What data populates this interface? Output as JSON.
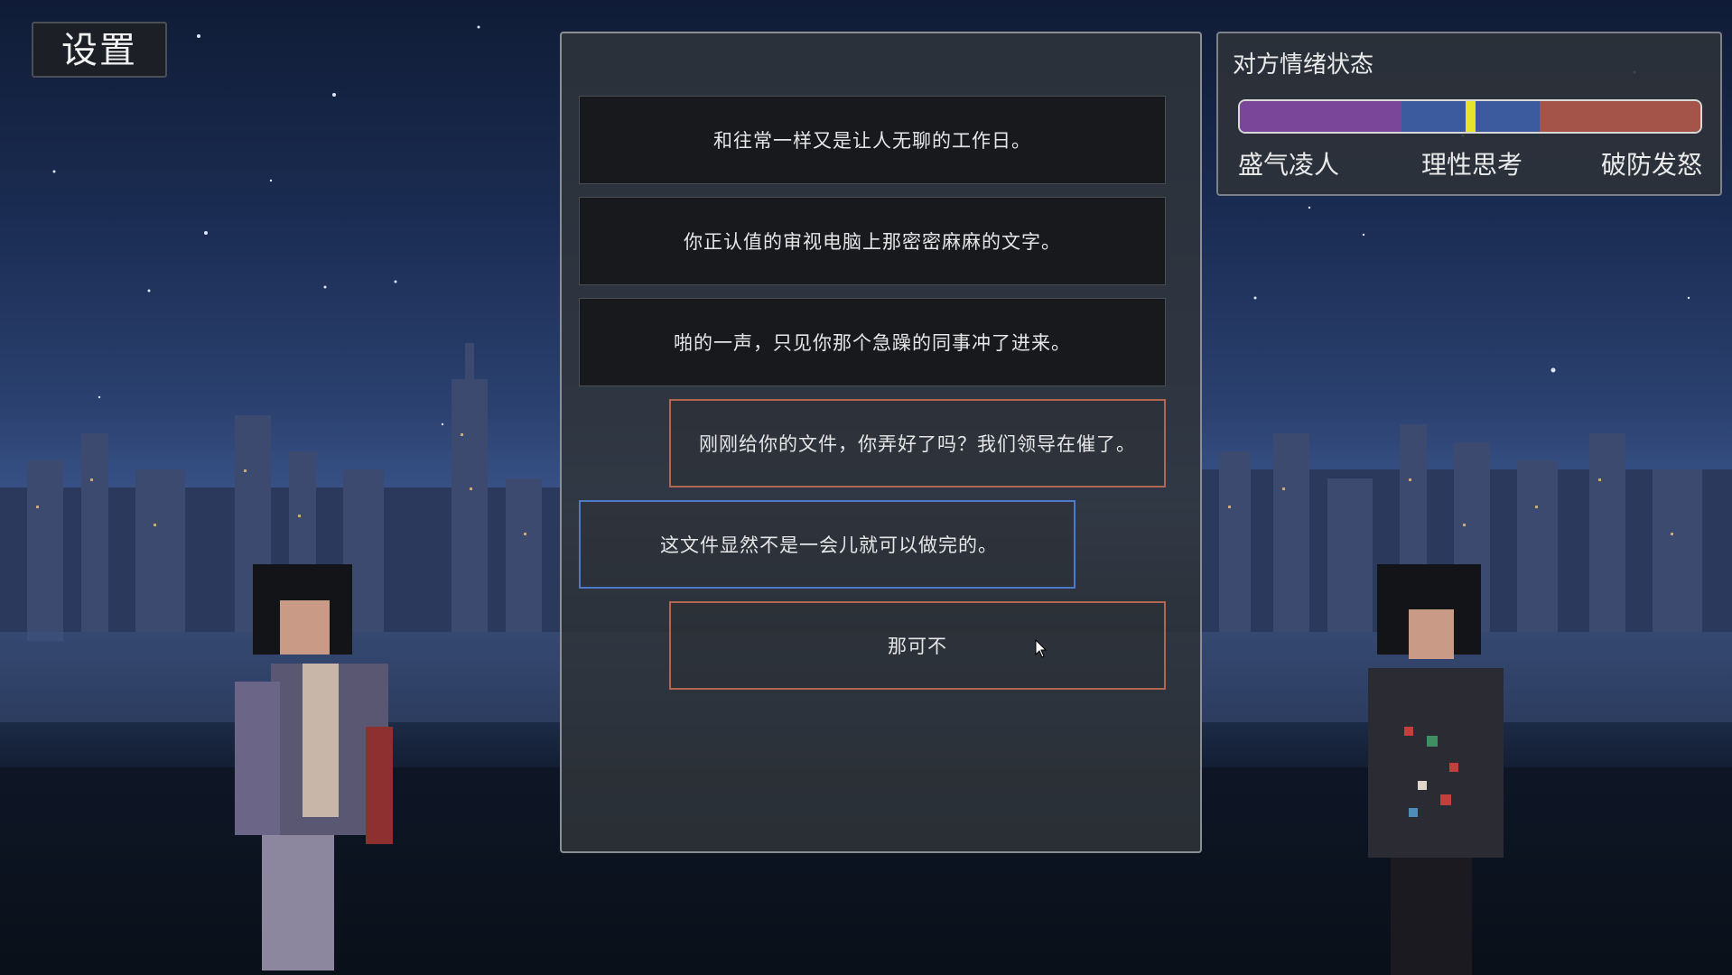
{
  "settings": {
    "label": "设置"
  },
  "dialog": {
    "messages": [
      {
        "type": "narration",
        "text": "和往常一样又是让人无聊的工作日。"
      },
      {
        "type": "narration",
        "text": "你正认值的审视电脑上那密密麻麻的文字。"
      },
      {
        "type": "narration",
        "text": "啪的一声，只见你那个急躁的同事冲了进来。"
      },
      {
        "type": "npc",
        "text": "刚刚给你的文件，你弄好了吗？我们领导在催了。"
      },
      {
        "type": "player",
        "text": "这文件显然不是一会儿就可以做完的。"
      },
      {
        "type": "npc",
        "text": "那可不"
      }
    ]
  },
  "mood": {
    "title": "对方情绪状态",
    "labels": [
      "盛气凌人",
      "理性思考",
      "破防发怒"
    ],
    "level": 0.5,
    "colors": {
      "domineering": "#7a4699",
      "rational": "#3c5b9f",
      "furious": "#a5544a",
      "marker": "#e6e52a"
    }
  },
  "icons": [
    "mouse-cursor-icon"
  ]
}
